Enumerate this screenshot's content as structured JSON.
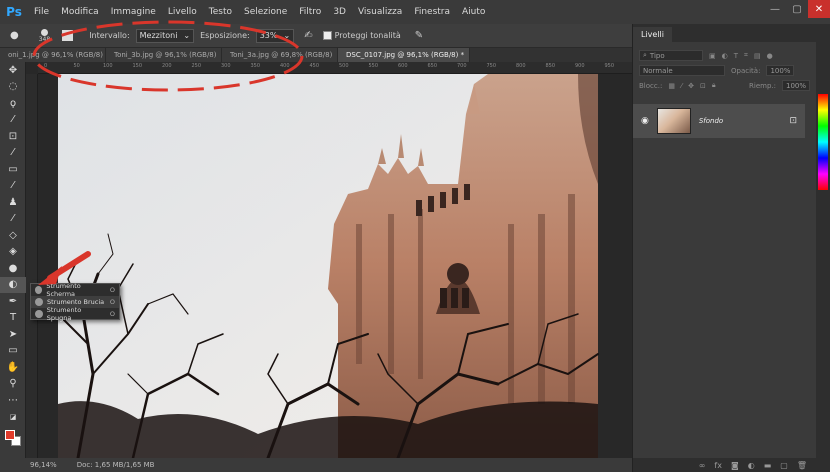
{
  "app": {
    "logo": "Ps"
  },
  "menu": [
    "File",
    "Modifica",
    "Immagine",
    "Livello",
    "Testo",
    "Selezione",
    "Filtro",
    "3D",
    "Visualizza",
    "Finestra",
    "Aiuto"
  ],
  "window_controls": [
    "—",
    "▢",
    "✕"
  ],
  "options": {
    "brush_size": "348",
    "range_label": "Intervallo:",
    "range_value": "Mezzitoni",
    "exposure_label": "Esposizione:",
    "exposure_value": "33%",
    "protect_label": "Proteggi tonalità"
  },
  "tabs": [
    {
      "label": "oni_1.jpg @ 96,1% (RGB/8) *",
      "close": "✕"
    },
    {
      "label": "Toni_3b.jpg @ 96,1% (RGB/8)",
      "close": "✕"
    },
    {
      "label": "Toni_3a.jpg @ 69,8% (RGB/8)",
      "close": "✕"
    },
    {
      "label": "DSC_0107.jpg @ 96,1% (RGB/8) *",
      "close": "✕"
    }
  ],
  "ruler_ticks": [
    "0",
    "50",
    "100",
    "150",
    "200",
    "250",
    "300",
    "350",
    "400",
    "450",
    "500",
    "550",
    "600",
    "650",
    "700",
    "750",
    "800",
    "850",
    "900",
    "950"
  ],
  "flyout": [
    {
      "label": "Strumento Scherma",
      "key": "O"
    },
    {
      "label": "Strumento Brucia",
      "key": "O"
    },
    {
      "label": "Strumento Spugna",
      "key": "O"
    }
  ],
  "status": {
    "zoom": "96,14%",
    "doc": "Doc: 1,65 MB/1,65 MB"
  },
  "layers_panel": {
    "title": "Livelli",
    "search": "Tipo",
    "blend": "Normale",
    "opacity_label": "Opacità:",
    "opacity_value": "100%",
    "lock_label": "Blocc.:",
    "fill_label": "Riemp.:",
    "fill_value": "100%",
    "layer_name": "Sfondo"
  },
  "colors": {
    "foreground": "#e03a2a",
    "background": "#ffffff",
    "annotation": "#d9362b"
  }
}
